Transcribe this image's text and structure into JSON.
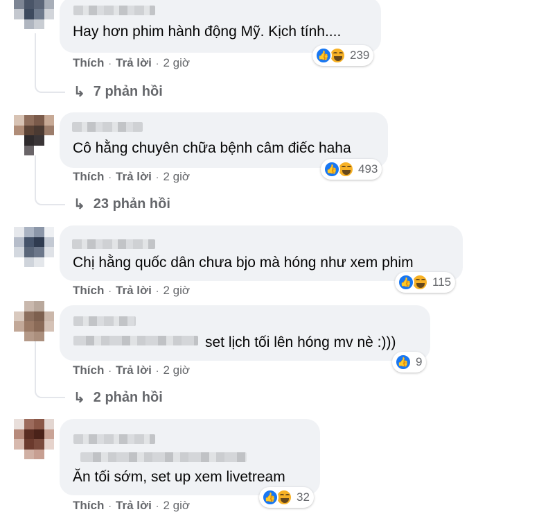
{
  "labels": {
    "like": "Thích",
    "reply": "Trả lời",
    "dot": "·"
  },
  "colors": {
    "like_blue": "#1877f2",
    "haha_yellow": "#f7b125",
    "bubble_bg": "#f0f2f5",
    "meta_gray": "#65676b"
  },
  "icons": {
    "like": "thumbs-up-icon",
    "haha": "laughing-face-icon",
    "reply_arrow": "reply-arrow-icon"
  },
  "comments": [
    {
      "text": "Hay hơn phim hành động Mỹ. Kịch tính....",
      "reaction_count": "239",
      "has_haha": true,
      "time": "2 giờ",
      "replies_arrow": "↳",
      "replies_label": "7 phản hồi"
    },
    {
      "text": "Cô hằng chuyên chữa bệnh câm điếc haha",
      "reaction_count": "493",
      "has_haha": true,
      "time": "2 giờ",
      "replies_arrow": "↳",
      "replies_label": "23 phản hồi"
    },
    {
      "text": "Chị hằng quốc dân chưa bjo mà hóng như xem phim",
      "reaction_count": "115",
      "has_haha": true,
      "time": "2 giờ"
    },
    {
      "text": "set lịch tối lên hóng mv nè :)))",
      "reaction_count": "9",
      "has_haha": false,
      "time": "2 giờ",
      "replies_arrow": "↳",
      "replies_label": "2 phản hồi"
    },
    {
      "text": "Ăn tối sớm, set up xem livetream",
      "reaction_count": "32",
      "has_haha": true,
      "time": "2 giờ"
    }
  ]
}
